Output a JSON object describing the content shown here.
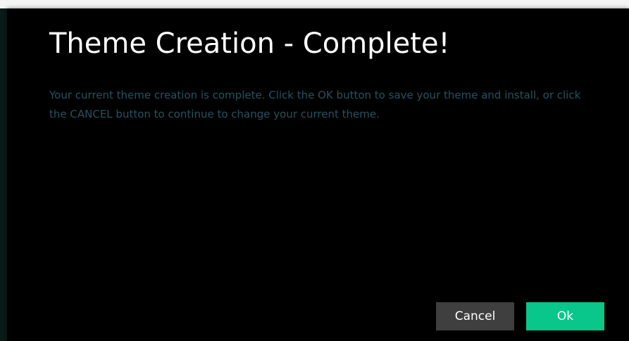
{
  "dialog": {
    "title": "Theme Creation - Complete!",
    "message": "Your current theme creation is complete. Click the OK button to save your theme and install, or click the CANCEL button to continue to change your current theme.",
    "buttons": {
      "cancel_label": "Cancel",
      "ok_label": "Ok"
    }
  },
  "colors": {
    "dialog_background": "#000000",
    "title_text": "#ffffff",
    "message_text": "#27525f",
    "cancel_button": "#3f3f3f",
    "ok_button": "#09c68a"
  }
}
